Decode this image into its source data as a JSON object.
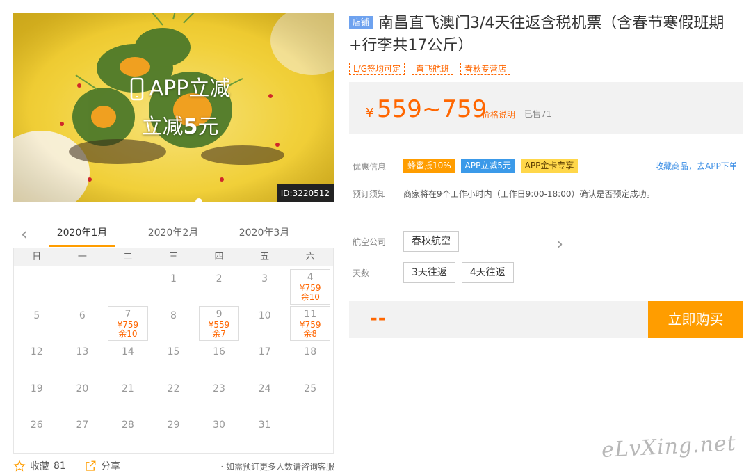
{
  "hero": {
    "app_label": "APP立减",
    "discount_prefix": "立减",
    "discount_amount": "5",
    "discount_suffix": "元",
    "id_badge": "ID:3220512",
    "icon": "mobile-phone-icon"
  },
  "calendar": {
    "months": [
      "2020年1月",
      "2020年2月",
      "2020年3月"
    ],
    "active_month": 0,
    "weekdays": [
      "日",
      "一",
      "二",
      "三",
      "四",
      "五",
      "六"
    ],
    "days": [
      {
        "day": ""
      },
      {
        "day": ""
      },
      {
        "day": ""
      },
      {
        "day": "1"
      },
      {
        "day": "2"
      },
      {
        "day": "3"
      },
      {
        "day": "4",
        "price": "¥759",
        "left": "余10"
      },
      {
        "day": "5"
      },
      {
        "day": "6"
      },
      {
        "day": "7",
        "price": "¥759",
        "left": "余10"
      },
      {
        "day": "8"
      },
      {
        "day": "9",
        "price": "¥559",
        "left": "余7"
      },
      {
        "day": "10"
      },
      {
        "day": "11",
        "price": "¥759",
        "left": "余8"
      },
      {
        "day": "12"
      },
      {
        "day": "13"
      },
      {
        "day": "14"
      },
      {
        "day": "15"
      },
      {
        "day": "16"
      },
      {
        "day": "17"
      },
      {
        "day": "18"
      },
      {
        "day": "19"
      },
      {
        "day": "20"
      },
      {
        "day": "21"
      },
      {
        "day": "22"
      },
      {
        "day": "23"
      },
      {
        "day": "24"
      },
      {
        "day": "25"
      },
      {
        "day": "26"
      },
      {
        "day": "27"
      },
      {
        "day": "28"
      },
      {
        "day": "29"
      },
      {
        "day": "30"
      },
      {
        "day": "31"
      },
      {
        "day": ""
      }
    ]
  },
  "bottom": {
    "favorite_label": "收藏",
    "favorite_count": "81",
    "share_label": "分享",
    "consult_text": "· 如需预订更多人数请咨询客服"
  },
  "product": {
    "shop_badge": "店铺",
    "title": "南昌直飞澳门3/4天往返含税机票（含春节寒假班期+行李共17公斤）",
    "tags": [
      "L/G签均可定",
      "直飞航班",
      "春秋专营店"
    ],
    "currency": "¥",
    "price_range": "559~759",
    "price_note": "价格说明",
    "sold": "已售71"
  },
  "promotions": {
    "label": "优惠信息",
    "items": [
      "蜂蜜抵10%",
      "APP立减5元",
      "APP金卡专享"
    ],
    "app_link": "收藏商品，去APP下单"
  },
  "notice": {
    "label": "预订须知",
    "text": "商家将在9个工作小时内（工作日9:00-18:00）确认是否预定成功。"
  },
  "options": {
    "airline_label": "航空公司",
    "airline": "春秋航空",
    "days_label": "天数",
    "days": [
      "3天往返",
      "4天往返"
    ]
  },
  "buy": {
    "quantity": "--",
    "button": "立即购买"
  },
  "watermark": "eLvXing.net",
  "colors": {
    "accent": "#ff9d00",
    "price": "#ff6600",
    "link": "#3b8ee5",
    "shop_badge": "#6ea2ef"
  }
}
